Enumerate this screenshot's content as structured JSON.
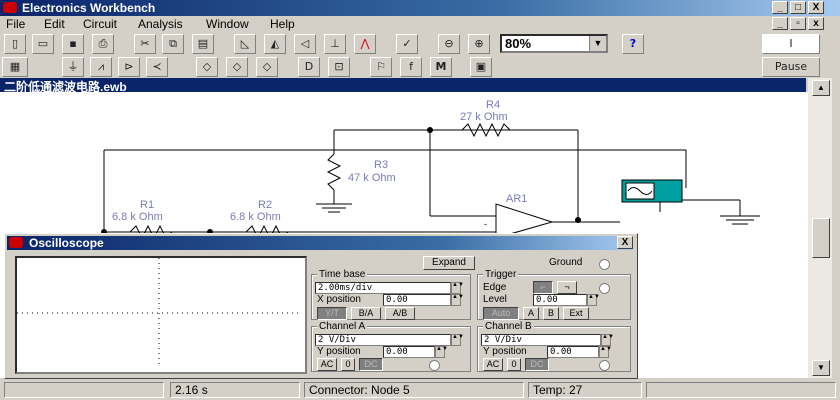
{
  "app": {
    "title": "Electronics Workbench",
    "window_buttons": [
      "_",
      "□",
      "X"
    ]
  },
  "menu": [
    "File",
    "Edit",
    "Circuit",
    "Analysis",
    "Window",
    "Help"
  ],
  "toolbar": {
    "zoom": "80%",
    "help": "?",
    "pause": "Pause",
    "power": "I"
  },
  "document": {
    "title": "二阶低通滤波电路.ewb"
  },
  "circuit": {
    "components": [
      {
        "name": "R4",
        "value": "27 k Ohm"
      },
      {
        "name": "R3",
        "value": "47 k Ohm"
      },
      {
        "name": "R1",
        "value": "6.8 k Ohm"
      },
      {
        "name": "R2",
        "value": "6.8 k Ohm"
      },
      {
        "name": "AR1",
        "value": ""
      }
    ]
  },
  "oscilloscope": {
    "title": "Oscilloscope",
    "close": "X",
    "expand": "Expand",
    "ground": "Ground",
    "timebase": {
      "label": "Time base",
      "value": "2.00ms/div",
      "xpos_label": "X position",
      "xpos": "0.00",
      "modes": [
        "Y/T",
        "B/A",
        "A/B"
      ]
    },
    "trigger": {
      "label": "Trigger",
      "edge_label": "Edge",
      "level_label": "Level",
      "level": "0.00",
      "buttons": [
        "Auto",
        "A",
        "B",
        "Ext"
      ]
    },
    "channel_a": {
      "label": "Channel A",
      "scale": "2 V/Div",
      "ypos_label": "Y position",
      "ypos": "0.00",
      "coupling": [
        "AC",
        "0",
        "DC"
      ]
    },
    "channel_b": {
      "label": "Channel B",
      "scale": "2 V/Div",
      "ypos_label": "Y position",
      "ypos": "0.00",
      "coupling": [
        "AC",
        "0",
        "DC"
      ]
    }
  },
  "status": {
    "time": "2.16 s",
    "connector": "Connector: Node 5",
    "temp": "Temp:  27"
  }
}
